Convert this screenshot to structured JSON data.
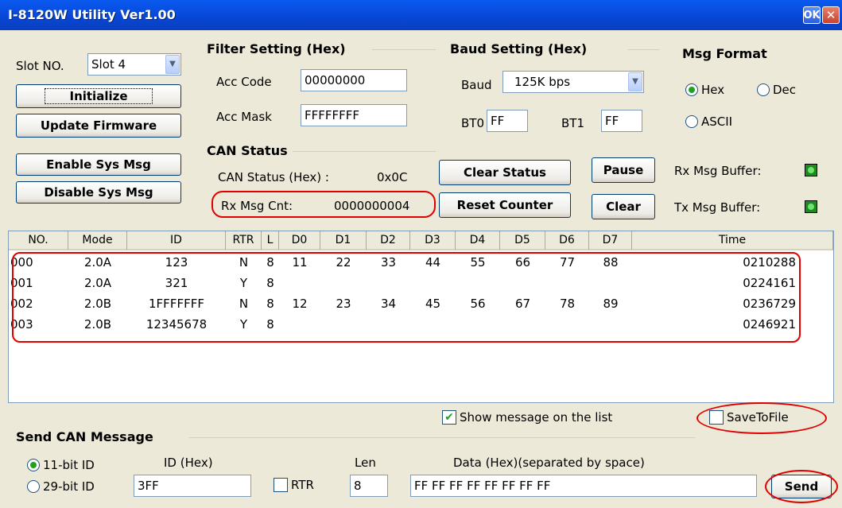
{
  "window": {
    "title": "I-8120W Utility Ver1.00",
    "ok_label": "OK",
    "close_label": "✕"
  },
  "slot": {
    "label": "Slot NO.",
    "value": "Slot 4"
  },
  "buttons": {
    "initialize": "Initialize",
    "update_firmware": "Update Firmware",
    "enable_sys_msg": "Enable Sys Msg",
    "disable_sys_msg": "Disable Sys Msg",
    "clear_status": "Clear Status",
    "reset_counter": "Reset Counter",
    "pause": "Pause",
    "clear": "Clear",
    "send": "Send"
  },
  "filter": {
    "title": "Filter Setting (Hex)",
    "acc_code_label": "Acc Code",
    "acc_code": "00000000",
    "acc_mask_label": "Acc Mask",
    "acc_mask": "FFFFFFFF"
  },
  "baud": {
    "title": "Baud Setting (Hex)",
    "baud_label": "Baud",
    "baud_value": "125K bps",
    "bt0_label": "BT0",
    "bt0": "FF",
    "bt1_label": "BT1",
    "bt1": "FF"
  },
  "msg_format": {
    "title": "Msg Format",
    "hex": "Hex",
    "dec": "Dec",
    "ascii": "ASCII",
    "selected": "Hex"
  },
  "can_status": {
    "title": "CAN Status",
    "status_label": "CAN Status (Hex) :",
    "status_value": "0x0C",
    "rx_cnt_label": "Rx Msg Cnt:",
    "rx_cnt_value": "0000000004"
  },
  "buffers": {
    "rx_label": "Rx Msg Buffer:",
    "tx_label": "Tx Msg Buffer:"
  },
  "table": {
    "columns": [
      "NO.",
      "Mode",
      "ID",
      "RTR",
      "L",
      "D0",
      "D1",
      "D2",
      "D3",
      "D4",
      "D5",
      "D6",
      "D7",
      "Time"
    ],
    "rows": [
      [
        "000",
        "2.0A",
        "123",
        "N",
        "8",
        "11",
        "22",
        "33",
        "44",
        "55",
        "66",
        "77",
        "88",
        "0210288"
      ],
      [
        "001",
        "2.0A",
        "321",
        "Y",
        "8",
        "",
        "",
        "",
        "",
        "",
        "",
        "",
        "",
        "0224161"
      ],
      [
        "002",
        "2.0B",
        "1FFFFFFF",
        "N",
        "8",
        "12",
        "23",
        "34",
        "45",
        "56",
        "67",
        "78",
        "89",
        "0236729"
      ],
      [
        "003",
        "2.0B",
        "12345678",
        "Y",
        "8",
        "",
        "",
        "",
        "",
        "",
        "",
        "",
        "",
        "0246921"
      ]
    ]
  },
  "options": {
    "show_on_list": "Show message on the list",
    "show_on_list_checked": true,
    "save_to_file": "SaveToFile",
    "save_to_file_checked": false
  },
  "send": {
    "title": "Send CAN Message",
    "bit11": "11-bit ID",
    "bit29": "29-bit ID",
    "selected": "11-bit ID",
    "id_label": "ID (Hex)",
    "id_value": "3FF",
    "rtr_label": "RTR",
    "rtr_checked": false,
    "len_label": "Len",
    "len_value": "8",
    "data_label": "Data (Hex)(separated by space)",
    "data_value": "FF FF FF FF FF FF FF FF"
  }
}
